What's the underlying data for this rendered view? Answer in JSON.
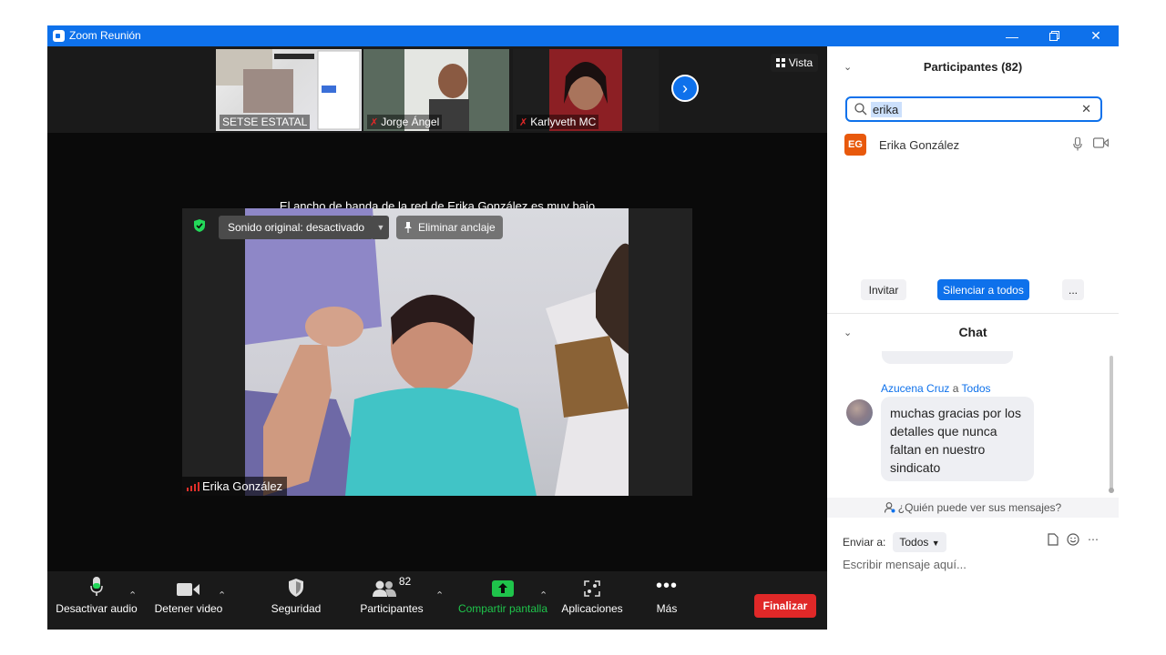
{
  "window": {
    "title": "Zoom Reunión"
  },
  "strip": {
    "thumbs": [
      {
        "name": "SETSE ESTATAL",
        "muted": false
      },
      {
        "name": "Jorge Ángel",
        "muted": true
      },
      {
        "name": "Karlyveth MC",
        "muted": true
      }
    ],
    "view_label": "Vista"
  },
  "stage": {
    "bandwidth_notice": "El ancho de banda de la red de Erika González es muy bajo",
    "original_sound_label": "Sonido original: desactivado",
    "unpin_label": "Eliminar anclaje",
    "speaker_name": "Erika González"
  },
  "toolbar": {
    "mute_label": "Desactivar audio",
    "video_label": "Detener video",
    "security_label": "Seguridad",
    "participants_label": "Participantes",
    "participants_count": "82",
    "share_label": "Compartir pantalla",
    "apps_label": "Aplicaciones",
    "more_label": "Más",
    "end_label": "Finalizar"
  },
  "participants_panel": {
    "title": "Participantes (82)",
    "search_value": "erika",
    "results": [
      {
        "initials": "EG",
        "name": "Erika González",
        "avatar_color": "#e8590c"
      }
    ],
    "invite_label": "Invitar",
    "mute_all_label": "Silenciar a todos",
    "more_label": "..."
  },
  "chat": {
    "title": "Chat",
    "messages": [
      {
        "sender": "Azucena Cruz",
        "connector": "a",
        "recipient": "Todos",
        "text": "muchas gracias por los detalles que nunca faltan en nuestro sindicato"
      }
    ],
    "who_can_see": "¿Quién puede ver sus mensajes?",
    "send_to_label": "Enviar a:",
    "send_to_value": "Todos",
    "input_placeholder": "Escribir mensaje aquí..."
  },
  "colors": {
    "accent": "#0e71eb",
    "end_button": "#e02828",
    "share_green": "#1fc44b",
    "toolbar_bg": "#1a1a1a"
  }
}
